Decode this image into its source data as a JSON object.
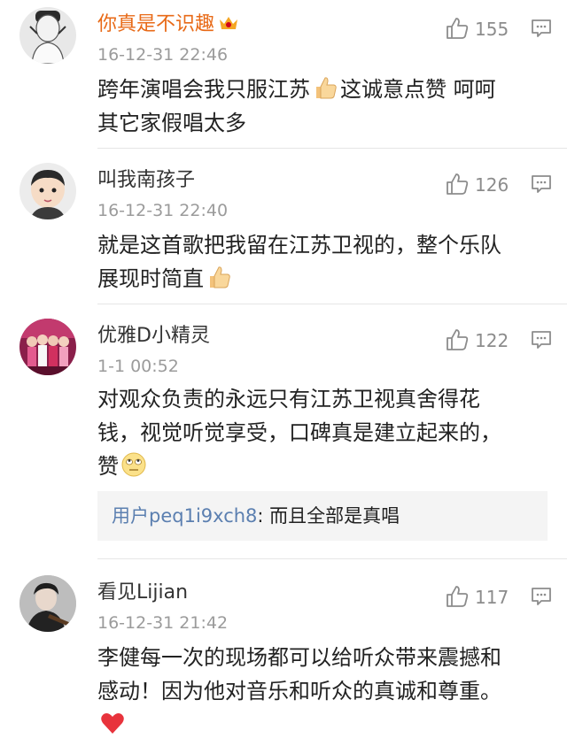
{
  "comments": [
    {
      "name": "你真是不识趣",
      "vip_icon": "crown-vip-icon",
      "time": "16-12-31 22:46",
      "likes": "155",
      "text_line1": "跨年演唱会我只服江苏",
      "text_line1b": "这诚意点赞  呵呵",
      "text_line2": "其它家假唱太多"
    },
    {
      "name": "叫我南孩子",
      "time": "16-12-31 22:40",
      "likes": "126",
      "text_line1": "就是这首歌把我留在江苏卫视的，整个乐队",
      "text_line2": "展现时简直"
    },
    {
      "name": "优雅D小精灵",
      "time": "1-1 00:52",
      "likes": "122",
      "text_line1": "对观众负责的永远只有江苏卫视真舍得花",
      "text_line2": "钱，视觉听觉享受，口碑真是建立起来的，",
      "text_line3": "赞",
      "reply": {
        "user": "用户peq1i9xch8",
        "text": ": 而且全部是真唱"
      }
    },
    {
      "name": "看见Lijian",
      "time": "16-12-31 21:42",
      "likes": "117",
      "text_line1": "李健每一次的现场都可以给听众带来震撼和",
      "text_line2": "感动！因为他对音乐和听众的真诚和尊重。"
    }
  ],
  "colors": {
    "vip_name": "#e86a17",
    "reply_user": "#5b7fb0",
    "meta_gray": "#9b9b9b"
  }
}
